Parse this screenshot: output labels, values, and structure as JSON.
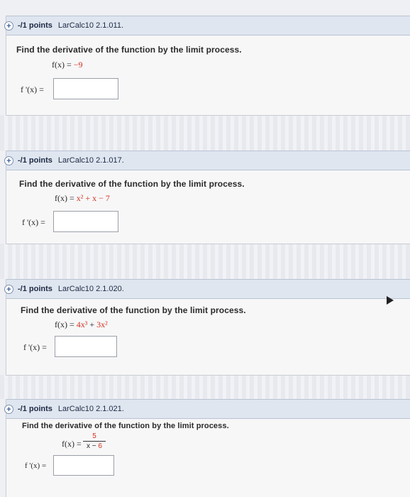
{
  "questions": [
    {
      "points": "-/1 points",
      "id": "LarCalc10 2.1.011.",
      "prompt": "Find the derivative of the function by the limit process.",
      "f_left": "f(x) = ",
      "f_value": "−9",
      "answer_label": "f '(x) ="
    },
    {
      "points": "-/1 points",
      "id": "LarCalc10 2.1.017.",
      "prompt": "Find the derivative of the function by the limit process.",
      "f_left": "f(x) = ",
      "f_value": "x² + x − 7",
      "answer_label": "f '(x) ="
    },
    {
      "points": "-/1 points",
      "id": "LarCalc10 2.1.020.",
      "prompt": "Find the derivative of the function by the limit process.",
      "f_left": "f(x) = ",
      "f_value_a": "4x³",
      "f_value_mid": " + ",
      "f_value_b": "3x²",
      "answer_label": "f '(x) ="
    },
    {
      "points": "-/1 points",
      "id": "LarCalc10 2.1.021.",
      "prompt": "Find the derivative of the function by the limit process.",
      "f_left": "f(x) = ",
      "frac_num": "5",
      "frac_den_a": "x − ",
      "frac_den_b": "6",
      "answer_label": "f '(x) ="
    }
  ],
  "icons": {
    "expand": "plus-circle-icon",
    "cursor": "mouse-pointer-icon"
  },
  "colors": {
    "header_bg": "#dfe6f0",
    "accent_red": "#d0311f"
  }
}
